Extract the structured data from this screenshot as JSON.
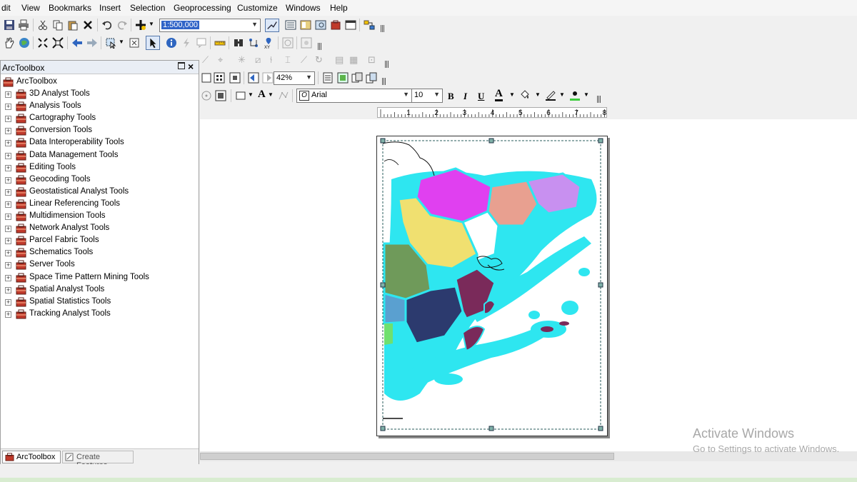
{
  "menubar": {
    "items": [
      "dit",
      "View",
      "Bookmarks",
      "Insert",
      "Selection",
      "Geoprocessing",
      "Customize",
      "Windows",
      "Help"
    ]
  },
  "toolbar": {
    "scale_value": "1:500,000",
    "zoom_value": "42%",
    "font_name": "Arial",
    "font_size": "10",
    "bold_label": "B",
    "italic_label": "I",
    "underline_label": "U",
    "font_color_label": "A",
    "text_tool_label": "A"
  },
  "toolbox": {
    "title": "ArcToolbox",
    "root": "ArcToolbox",
    "items": [
      "3D Analyst Tools",
      "Analysis Tools",
      "Cartography Tools",
      "Conversion Tools",
      "Data Interoperability Tools",
      "Data Management Tools",
      "Editing Tools",
      "Geocoding Tools",
      "Geostatistical Analyst Tools",
      "Linear Referencing Tools",
      "Multidimension Tools",
      "Network Analyst Tools",
      "Parcel Fabric Tools",
      "Schematics Tools",
      "Server Tools",
      "Space Time Pattern Mining Tools",
      "Spatial Analyst Tools",
      "Spatial Statistics Tools",
      "Tracking Analyst Tools"
    ],
    "tabs": [
      "ArcToolbox",
      "Create Features"
    ]
  },
  "ruler": {
    "ticks": [
      "1",
      "2",
      "3",
      "4",
      "5",
      "6",
      "7",
      "8"
    ]
  },
  "watermark": {
    "title": "Activate Windows",
    "subtitle": "Go to Settings to activate Windows."
  },
  "colors": {
    "toolbox_icon": "#c0392b",
    "map_cyan": "#2ee6f0",
    "map_magenta": "#e040f0",
    "map_salmon": "#e8a090",
    "map_lavender": "#c890f0",
    "map_yellow": "#f0e070",
    "map_green": "#6f9a5a",
    "map_navy": "#2c3a6e",
    "map_plum": "#7a2a5a",
    "map_blue": "#5aa0d0"
  }
}
